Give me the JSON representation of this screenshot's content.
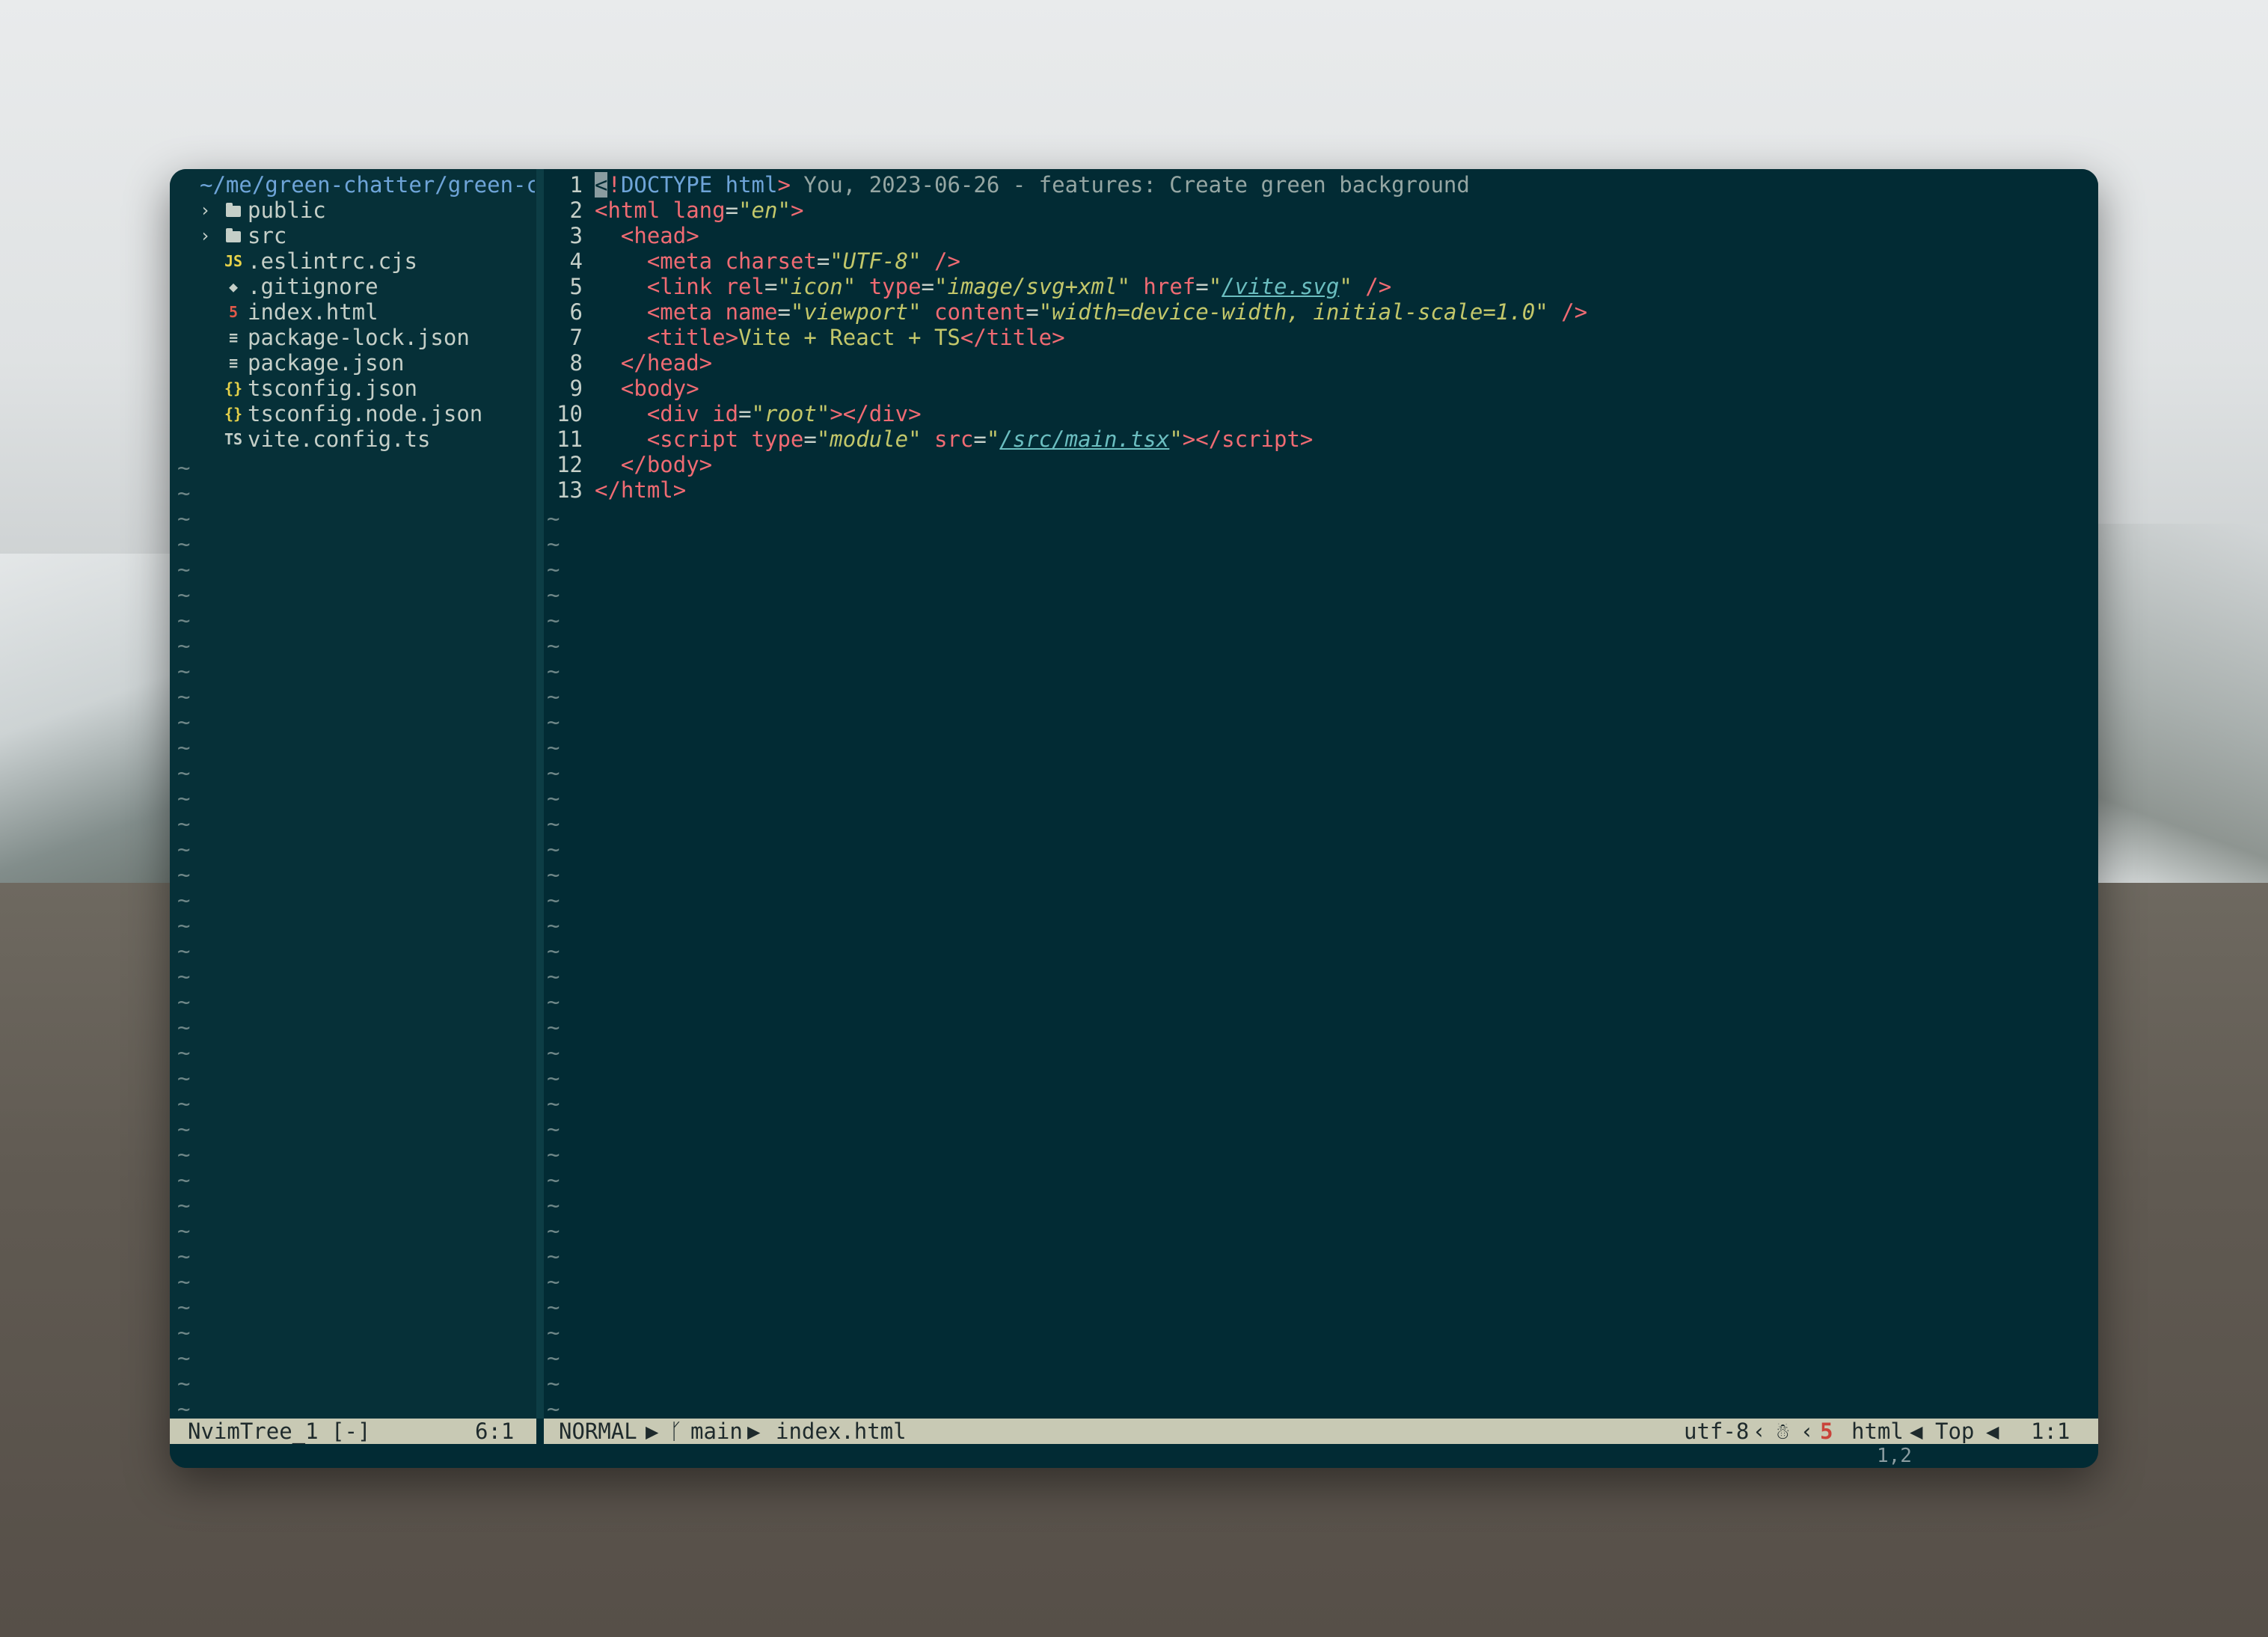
{
  "tree": {
    "path": "~/me/green-chatter/green-cha",
    "items": [
      {
        "type": "folder",
        "name": "public",
        "icon": "folder-icon"
      },
      {
        "type": "folder",
        "name": "src",
        "icon": "folder-icon"
      },
      {
        "type": "file",
        "name": ".eslintrc.cjs",
        "icon": "JS",
        "icon_color": "#e6d24a"
      },
      {
        "type": "file",
        "name": ".gitignore",
        "icon": "◆",
        "icon_color": "#c5cfc8"
      },
      {
        "type": "file",
        "name": "index.html",
        "icon": "5",
        "icon_color": "#e2594a"
      },
      {
        "type": "file",
        "name": "package-lock.json",
        "icon": "≡",
        "icon_color": "#c5cfc8"
      },
      {
        "type": "file",
        "name": "package.json",
        "icon": "≡",
        "icon_color": "#c5cfc8"
      },
      {
        "type": "file",
        "name": "tsconfig.json",
        "icon": "{}",
        "icon_color": "#e6d24a"
      },
      {
        "type": "file",
        "name": "tsconfig.node.json",
        "icon": "{}",
        "icon_color": "#e6d24a"
      },
      {
        "type": "file",
        "name": "vite.config.ts",
        "icon": "TS",
        "icon_color": "#c5cfc8"
      }
    ],
    "tilde": "~"
  },
  "editor": {
    "line_numbers": [
      "1",
      "2",
      "3",
      "4",
      "5",
      "6",
      "7",
      "8",
      "9",
      "10",
      "11",
      "12",
      "13"
    ],
    "blame": "You, 2023-06-26 - features: Create green background",
    "tilde": "~"
  },
  "status": {
    "tree_name": "NvimTree_1 [-]",
    "tree_pos": "6:1",
    "mode": "NORMAL",
    "branch": "main",
    "file": "index.html",
    "encoding": "utf-8",
    "filetype": "html",
    "scroll": "Top",
    "position": "1:1"
  },
  "cmdline": {
    "ruler": "1,2"
  },
  "colors": {
    "editor_bg": "#022b34",
    "tag": "#f06b73",
    "string": "#c3c76a",
    "link": "#6bbec0",
    "statusline": "#c8c9b4"
  }
}
